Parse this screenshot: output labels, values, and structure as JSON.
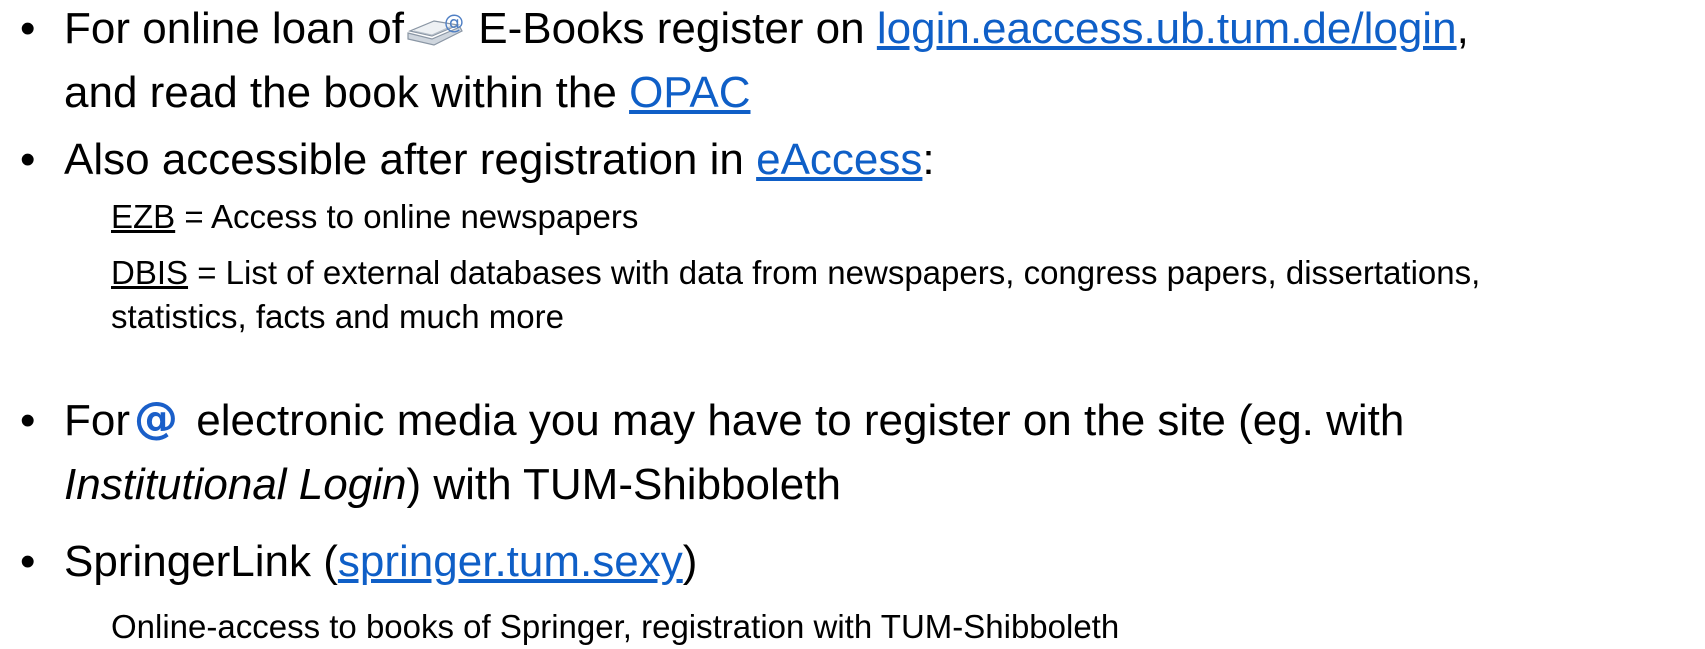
{
  "bullet_char": "•",
  "b1": {
    "pre": "For online loan of",
    "mid": " E-Books register on ",
    "link1": "login.eaccess.ub.tum.de/login",
    "comma": ",",
    "line2_pre": "and read the book within the ",
    "link2": "OPAC"
  },
  "b2": {
    "pre": "Also accessible after registration in ",
    "link": "eAccess",
    "post": ":"
  },
  "sub_ezb": {
    "term": "EZB",
    "desc": " = Access to online newspapers"
  },
  "sub_dbis": {
    "term": "DBIS",
    "desc": " = List of external databases with data from newspapers, congress papers, dissertations,",
    "line2": "statistics, facts and much more"
  },
  "b3": {
    "pre": "For",
    "mid": " electronic media you may have to register on the site (eg. with",
    "italic": "Institutional Login",
    "post": ") with TUM-Shibboleth"
  },
  "b4": {
    "pre": "SpringerLink (",
    "link": "springer.tum.sexy",
    "post": ")"
  },
  "sub_springer": {
    "text": "Online-access to books of Springer, registration with TUM-Shibboleth"
  },
  "icons": {
    "ebook": "ebook-at-icon",
    "at": "at-sign-icon"
  },
  "colors": {
    "link": "#0f5fc7",
    "at_icon": "#1a5fc9"
  }
}
